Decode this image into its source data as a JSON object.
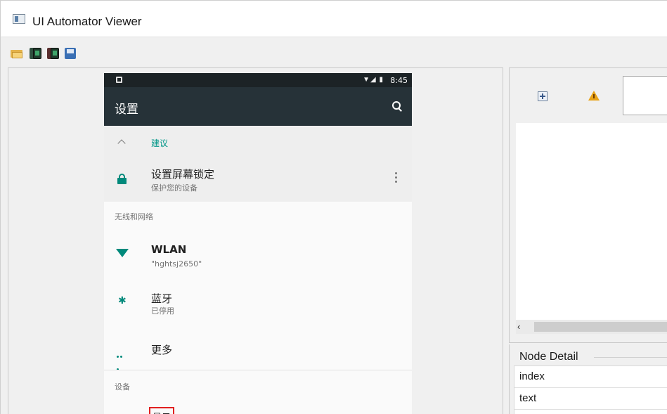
{
  "window": {
    "title": "UI Automator Viewer"
  },
  "toolbar": {
    "buttons": [
      {
        "icon": "open-folder-icon"
      },
      {
        "icon": "device-screenshot-icon"
      },
      {
        "icon": "device-screenshot-compressed-icon"
      },
      {
        "icon": "save-icon"
      }
    ]
  },
  "device": {
    "status_bar": {
      "time": "8:45",
      "icons": "▼◢ ▮"
    },
    "app_bar": {
      "title": "设置"
    },
    "suggestions": {
      "header": "建议",
      "item": {
        "title": "设置屏幕锁定",
        "subtitle": "保护您的设备"
      }
    },
    "sections": {
      "wireless": "无线和网络",
      "device": "设备"
    },
    "items": {
      "wlan": {
        "title": "WLAN",
        "subtitle": "\"hghtsj2650\""
      },
      "bluetooth": {
        "title": "蓝牙",
        "subtitle": "已停用",
        "icon_glyph": "✱"
      },
      "more": {
        "title": "更多"
      }
    },
    "highlighted_item": {
      "text": "显示"
    },
    "colors": {
      "app_bar": "#263238",
      "status_bar": "#1c2326",
      "accent": "#009688",
      "highlight": "#e02020"
    }
  },
  "right_panel": {
    "scroll_left_glyph": "‹"
  },
  "node_detail": {
    "label": "Node Detail",
    "rows": [
      {
        "key": "index"
      },
      {
        "key": "text"
      },
      {
        "key": ""
      }
    ]
  }
}
